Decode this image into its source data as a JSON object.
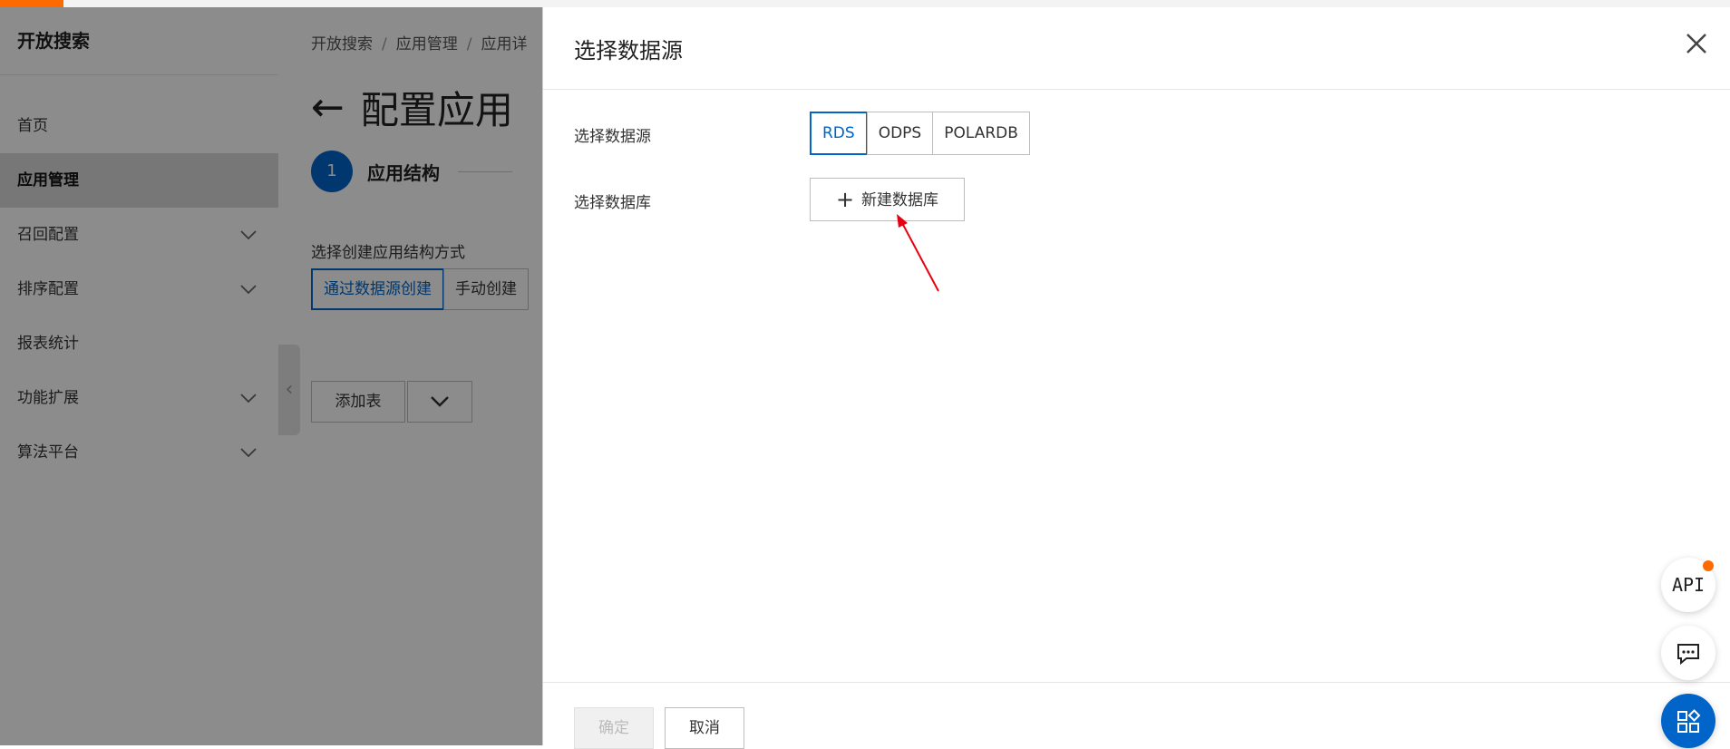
{
  "sidebar": {
    "title": "开放搜索",
    "items": [
      {
        "label": "首页"
      },
      {
        "label": "应用管理"
      },
      {
        "label": "召回配置"
      },
      {
        "label": "排序配置"
      },
      {
        "label": "报表统计"
      },
      {
        "label": "功能扩展"
      },
      {
        "label": "算法平台"
      }
    ]
  },
  "main": {
    "breadcrumb": [
      "开放搜索",
      "应用管理",
      "应用详"
    ],
    "page_title": "配置应用",
    "step_number": "1",
    "step_label": "应用结构",
    "method_label": "选择创建应用结构方式",
    "method_options": [
      "通过数据源创建",
      "手动创建"
    ],
    "add_table_label": "添加表"
  },
  "drawer": {
    "title": "选择数据源",
    "source_label": "选择数据源",
    "sources": [
      "RDS",
      "ODPS",
      "POLARDB"
    ],
    "selected_source": "RDS",
    "db_label": "选择数据库",
    "new_db_label": "新建数据库",
    "ok_label": "确定",
    "cancel_label": "取消"
  },
  "fabs": {
    "api_label": "API"
  },
  "icons": {
    "close": "close-icon",
    "plus": "plus-icon",
    "back": "arrow-left-icon",
    "chevron": "chevron-down-icon",
    "chat": "chat-icon",
    "apps": "apps-icon"
  },
  "colors": {
    "accent": "#0064c8",
    "brand": "#ff6a00",
    "annotation_arrow": "#e60012"
  }
}
